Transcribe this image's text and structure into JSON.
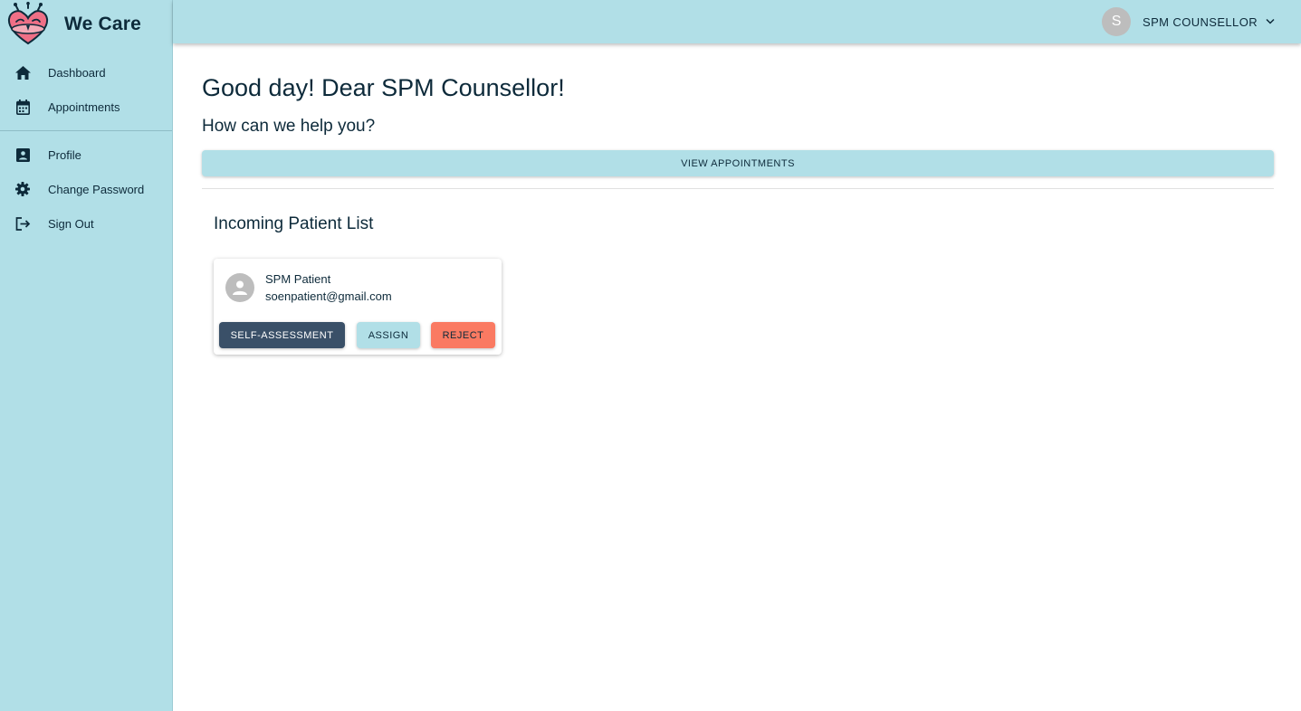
{
  "app": {
    "title": "We Care"
  },
  "colors": {
    "sidebar_bg": "#b1dfe7",
    "text_primary": "#0d2a3a",
    "self_assessment_btn": "#3a5068",
    "assign_btn": "#b1dfe7",
    "reject_btn": "#fa7a62"
  },
  "sidebar": {
    "primary_items": [
      {
        "label": "Dashboard",
        "icon": "home-icon"
      },
      {
        "label": "Appointments",
        "icon": "calendar-icon"
      }
    ],
    "secondary_items": [
      {
        "label": "Profile",
        "icon": "profile-card-icon"
      },
      {
        "label": "Change Password",
        "icon": "gear-icon"
      },
      {
        "label": "Sign Out",
        "icon": "sign-out-icon"
      }
    ]
  },
  "topbar": {
    "avatar_initial": "S",
    "user_name": "SPM COUNSELLOR",
    "menu_icon": "chevron-down-icon"
  },
  "main": {
    "greeting": "Good day! Dear SPM Counsellor!",
    "subgreeting": "How can we help you?",
    "view_appointments_label": "VIEW APPOINTMENTS",
    "incoming_title": "Incoming Patient List",
    "patients": [
      {
        "name": "SPM Patient",
        "email": "soenpatient@gmail.com",
        "avatar_icon": "person-icon",
        "actions": {
          "self_assessment": "SELF-ASSESSMENT",
          "assign": "ASSIGN",
          "reject": "REJECT"
        }
      }
    ]
  }
}
